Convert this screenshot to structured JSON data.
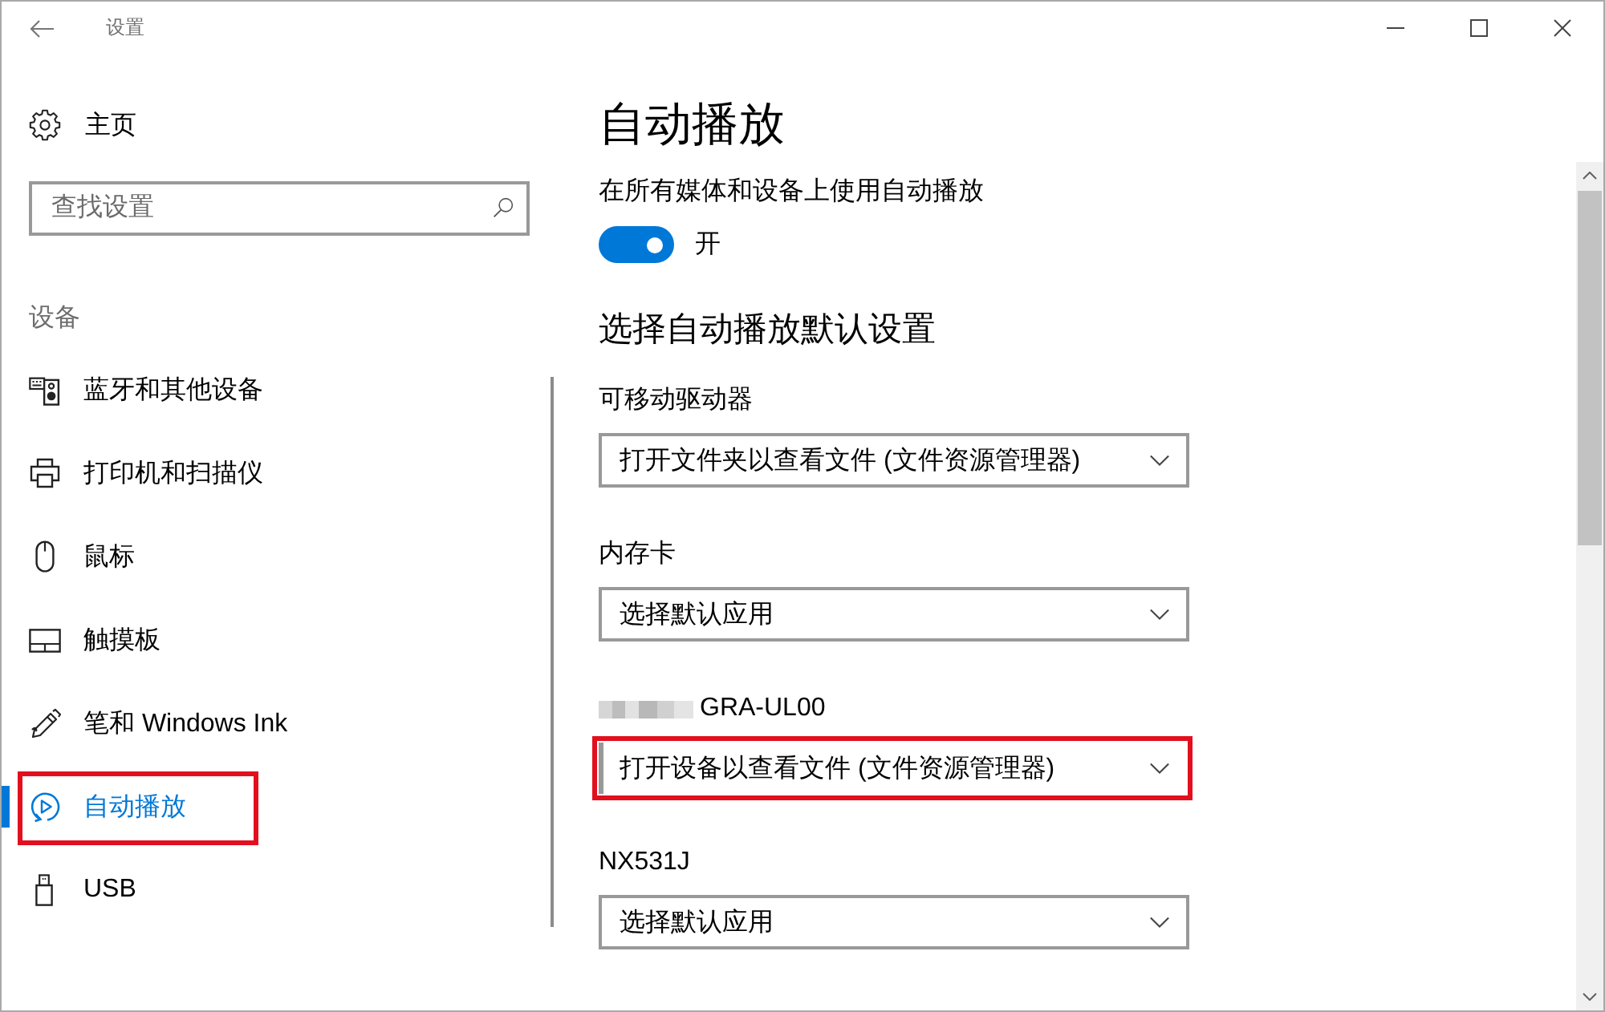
{
  "window": {
    "title": "设置"
  },
  "sidebar": {
    "home": "主页",
    "search": {
      "placeholder": "查找设置"
    },
    "section": "设备",
    "items": [
      {
        "label": "蓝牙和其他设备",
        "selected": false,
        "highlighted": false
      },
      {
        "label": "打印机和扫描仪",
        "selected": false,
        "highlighted": false
      },
      {
        "label": "鼠标",
        "selected": false,
        "highlighted": false
      },
      {
        "label": "触摸板",
        "selected": false,
        "highlighted": false
      },
      {
        "label": "笔和 Windows Ink",
        "selected": false,
        "highlighted": false
      },
      {
        "label": "自动播放",
        "selected": true,
        "highlighted": true
      },
      {
        "label": "USB",
        "selected": false,
        "highlighted": false
      }
    ]
  },
  "main": {
    "title": "自动播放",
    "autoplay": {
      "label": "在所有媒体和设备上使用自动播放",
      "on": true,
      "state": "开"
    },
    "heading": "选择自动播放默认设置",
    "devices": [
      {
        "label": "可移动驱动器",
        "redacted": false,
        "value": "打开文件夹以查看文件 (文件资源管理器)",
        "highlighted": false
      },
      {
        "label": "内存卡",
        "redacted": false,
        "value": "选择默认应用",
        "highlighted": false
      },
      {
        "label": "GRA-UL00",
        "redacted": true,
        "value": "打开设备以查看文件 (文件资源管理器)",
        "highlighted": true
      },
      {
        "label": "NX531J",
        "redacted": false,
        "value": "选择默认应用",
        "highlighted": false
      }
    ]
  }
}
